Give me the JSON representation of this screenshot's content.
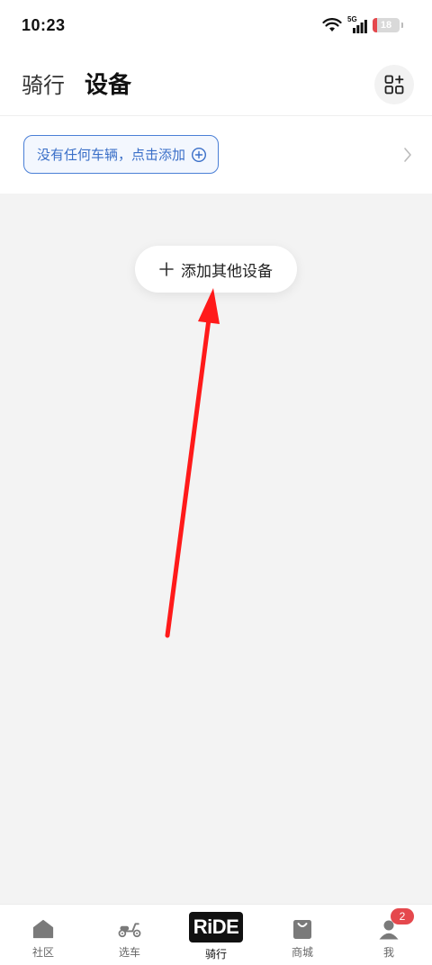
{
  "status_bar": {
    "time": "10:23",
    "network": "5G",
    "battery": "18",
    "battery_fraction": 0.18,
    "battery_color": "#e5484d"
  },
  "header": {
    "tabs": [
      {
        "label": "骑行",
        "active": false
      },
      {
        "label": "设备",
        "active": true
      }
    ],
    "action_icon": "grid-add-icon"
  },
  "vehicle": {
    "add_prompt": "没有任何车辆，点击添加",
    "accent": "#3a6fc8"
  },
  "content": {
    "add_device_label": "添加其他设备",
    "background": "#f3f3f3"
  },
  "annotation": {
    "type": "arrow",
    "color": "#ff1a1a"
  },
  "bottom_nav": {
    "items": [
      {
        "label": "社区",
        "icon": "home-icon"
      },
      {
        "label": "选车",
        "icon": "scooter-icon"
      },
      {
        "label": "骑行",
        "icon": "ride-logo",
        "logo_text": "RiDE",
        "active": true
      },
      {
        "label": "商城",
        "icon": "shop-bag-icon"
      },
      {
        "label": "我",
        "icon": "profile-icon",
        "badge": "2"
      }
    ]
  }
}
